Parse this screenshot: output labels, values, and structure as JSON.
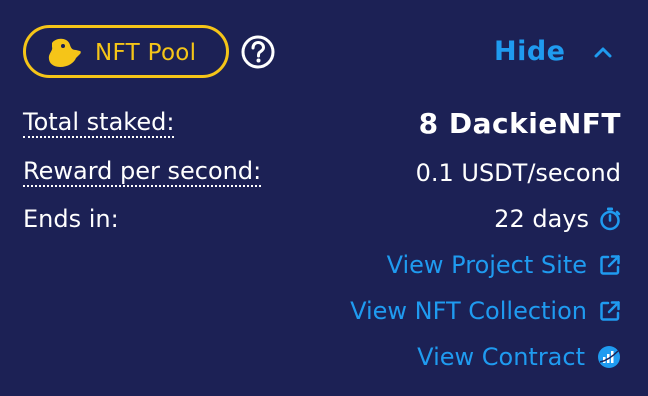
{
  "header": {
    "badge_label": "NFT Pool",
    "hide_label": "Hide"
  },
  "details": {
    "total_staked_label": "Total staked:",
    "total_staked_value": "8 DackieNFT",
    "reward_label": "Reward per second:",
    "reward_value": "0.1 USDT/second",
    "ends_label": "Ends in:",
    "ends_value": "22 days"
  },
  "links": {
    "project_site": "View Project Site",
    "nft_collection": "View NFT Collection",
    "contract": "View Contract"
  },
  "icons": {
    "badge": "duck-icon",
    "help": "question-circle-icon",
    "toggle": "chevron-up-icon",
    "timer": "stopwatch-icon",
    "external": "external-link-icon",
    "explorer": "explorer-icon"
  },
  "colors": {
    "background": "#1c2155",
    "accent": "#1f9bf0",
    "badge": "#f5c518",
    "text": "#ffffff"
  }
}
